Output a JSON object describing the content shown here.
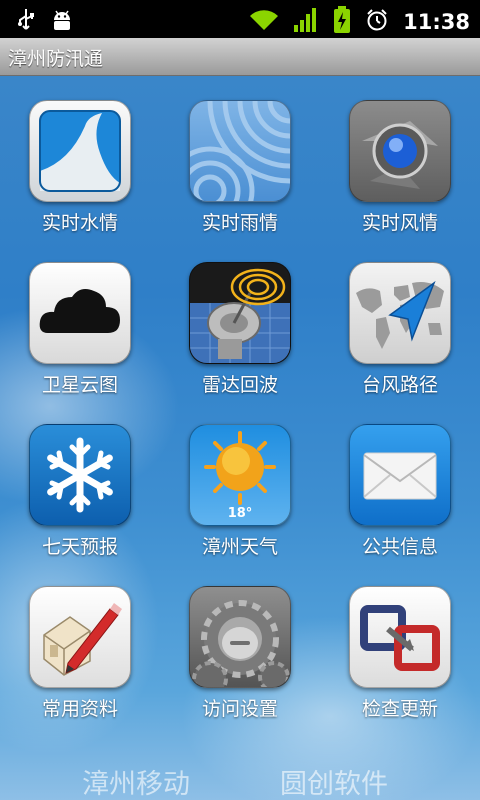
{
  "status_bar": {
    "time": "11:38",
    "icons": [
      "usb-icon",
      "android-debug-icon",
      "wifi-icon",
      "signal-icon",
      "battery-charging-icon",
      "alarm-icon"
    ]
  },
  "app": {
    "title": "漳州防汛通"
  },
  "apps": [
    {
      "id": "water",
      "label": "实时水情",
      "icon": "wave-icon"
    },
    {
      "id": "rain",
      "label": "实时雨情",
      "icon": "rain-waves-icon"
    },
    {
      "id": "wind",
      "label": "实时风情",
      "icon": "wind-orb-icon"
    },
    {
      "id": "satellite",
      "label": "卫星云图",
      "icon": "cloud-icon"
    },
    {
      "id": "radar",
      "label": "雷达回波",
      "icon": "radar-dish-icon"
    },
    {
      "id": "typhoon",
      "label": "台风路径",
      "icon": "map-arrow-icon"
    },
    {
      "id": "forecast",
      "label": "七天预报",
      "icon": "snowflake-icon"
    },
    {
      "id": "weather",
      "label": "漳州天气",
      "icon": "sun-icon",
      "temp": "18°"
    },
    {
      "id": "notice",
      "label": "公共信息",
      "icon": "envelope-icon"
    },
    {
      "id": "docs",
      "label": "常用资料",
      "icon": "sketch-pencil-icon"
    },
    {
      "id": "settings",
      "label": "访问设置",
      "icon": "gears-icon"
    },
    {
      "id": "update",
      "label": "检查更新",
      "icon": "update-squares-icon"
    }
  ],
  "footer": {
    "left": "漳州移动",
    "right": "圆创软件"
  },
  "colors": {
    "sky_blue": "#3a86c9",
    "status_bar": "#000000",
    "title_bar": "#b4b4b4"
  }
}
